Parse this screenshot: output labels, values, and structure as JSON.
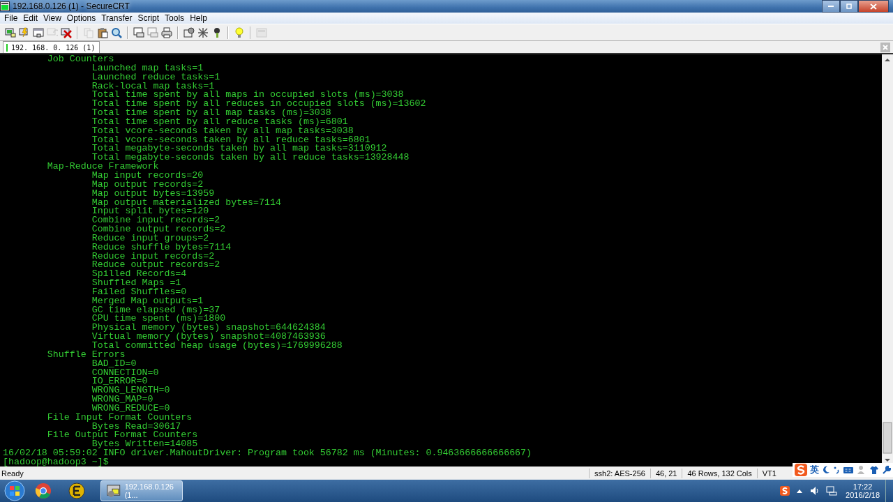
{
  "window": {
    "title": "192.168.0.126 (1) - SecureCRT"
  },
  "menu": [
    "File",
    "Edit",
    "View",
    "Options",
    "Transfer",
    "Script",
    "Tools",
    "Help"
  ],
  "toolbar": [
    {
      "kind": "connect",
      "disabled": false
    },
    {
      "kind": "quick",
      "disabled": false
    },
    {
      "kind": "tab",
      "disabled": false
    },
    {
      "kind": "reconnect",
      "disabled": true
    },
    {
      "kind": "disconnect",
      "disabled": false
    },
    {
      "kind": "separator"
    },
    {
      "kind": "copy",
      "disabled": true
    },
    {
      "kind": "paste",
      "disabled": false
    },
    {
      "kind": "find",
      "disabled": false
    },
    {
      "kind": "separator"
    },
    {
      "kind": "print",
      "disabled": false
    },
    {
      "kind": "print",
      "disabled": true
    },
    {
      "kind": "printer",
      "disabled": false
    },
    {
      "kind": "separator"
    },
    {
      "kind": "options",
      "disabled": false
    },
    {
      "kind": "keymap",
      "disabled": false
    },
    {
      "kind": "key",
      "disabled": false
    },
    {
      "kind": "separator"
    },
    {
      "kind": "help",
      "disabled": false
    },
    {
      "kind": "separator"
    },
    {
      "kind": "screen",
      "disabled": true
    }
  ],
  "tabs": [
    {
      "label": "192. 168. 0. 126  (1)",
      "selected": true
    }
  ],
  "terminal": {
    "lines": [
      "        Job Counters ",
      "                Launched map tasks=1",
      "                Launched reduce tasks=1",
      "                Rack-local map tasks=1",
      "                Total time spent by all maps in occupied slots (ms)=3038",
      "                Total time spent by all reduces in occupied slots (ms)=13602",
      "                Total time spent by all map tasks (ms)=3038",
      "                Total time spent by all reduce tasks (ms)=6801",
      "                Total vcore-seconds taken by all map tasks=3038",
      "                Total vcore-seconds taken by all reduce tasks=6801",
      "                Total megabyte-seconds taken by all map tasks=3110912",
      "                Total megabyte-seconds taken by all reduce tasks=13928448",
      "        Map-Reduce Framework",
      "                Map input records=20",
      "                Map output records=2",
      "                Map output bytes=13959",
      "                Map output materialized bytes=7114",
      "                Input split bytes=120",
      "                Combine input records=2",
      "                Combine output records=2",
      "                Reduce input groups=2",
      "                Reduce shuffle bytes=7114",
      "                Reduce input records=2",
      "                Reduce output records=2",
      "                Spilled Records=4",
      "                Shuffled Maps =1",
      "                Failed Shuffles=0",
      "                Merged Map outputs=1",
      "                GC time elapsed (ms)=37",
      "                CPU time spent (ms)=1800",
      "                Physical memory (bytes) snapshot=644624384",
      "                Virtual memory (bytes) snapshot=4087463936",
      "                Total committed heap usage (bytes)=1769996288",
      "        Shuffle Errors",
      "                BAD_ID=0",
      "                CONNECTION=0",
      "                IO_ERROR=0",
      "                WRONG_LENGTH=0",
      "                WRONG_MAP=0",
      "                WRONG_REDUCE=0",
      "        File Input Format Counters ",
      "                Bytes Read=30617",
      "        File Output Format Counters ",
      "                Bytes Written=14085",
      "16/02/18 05:59:02 INFO driver.MahoutDriver: Program took 56782 ms (Minutes: 0.9463666666666667)",
      "[hadoop@hadoop3 ~]$ "
    ]
  },
  "status_bar": {
    "text": "Ready",
    "cells": [
      "ssh2: AES-256",
      "46,  21",
      "46 Rows, 132 Cols",
      "VT1"
    ]
  },
  "ime_toolbar": {
    "language": "英"
  },
  "taskbar": {
    "tasks": [
      {
        "label": "192.168.0.126 (1...",
        "selected": true
      }
    ],
    "time": "17:22",
    "date": "2016/2/18"
  }
}
